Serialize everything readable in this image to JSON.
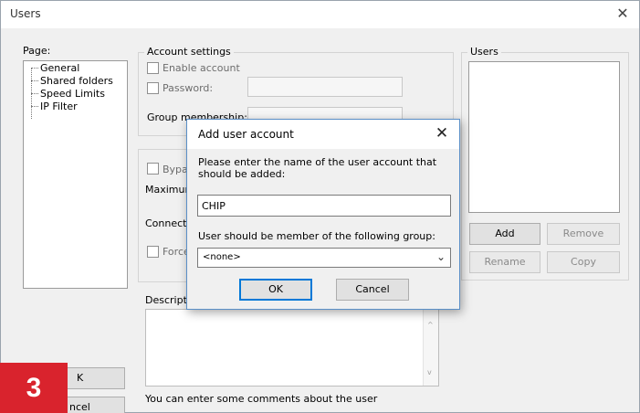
{
  "window": {
    "title": "Users"
  },
  "page_panel": {
    "label": "Page:",
    "items": [
      "General",
      "Shared folders",
      "Speed Limits",
      "IP Filter"
    ]
  },
  "account_settings": {
    "title": "Account settings",
    "enable_account": "Enable account",
    "password": "Password:",
    "group_membership": "Group membership:"
  },
  "options_partial": {
    "bypass": "Bypas",
    "maximum": "Maximum",
    "connections": "Connecti",
    "force": "Force"
  },
  "description": {
    "label": "Descriptio",
    "hint": "You can enter some comments about the user"
  },
  "users_panel": {
    "title": "Users",
    "add": "Add",
    "remove": "Remove",
    "rename": "Rename",
    "copy": "Copy"
  },
  "left_buttons": {
    "ok_partial": "K",
    "cancel_partial": "ncel"
  },
  "badge": {
    "number": "3",
    "color": "#d9232d"
  },
  "dialog": {
    "title": "Add user account",
    "prompt": "Please enter the name of the user account that should be added:",
    "username_value": "CHIP",
    "group_label": "User should be member of the following group:",
    "group_selected": "<none>",
    "ok": "OK",
    "cancel": "Cancel"
  },
  "icons": {
    "close": "close-icon",
    "dropdown": "chevron-down-icon",
    "scroll_up": "scroll-up-arrow-icon",
    "scroll_down": "scroll-down-arrow-icon"
  }
}
